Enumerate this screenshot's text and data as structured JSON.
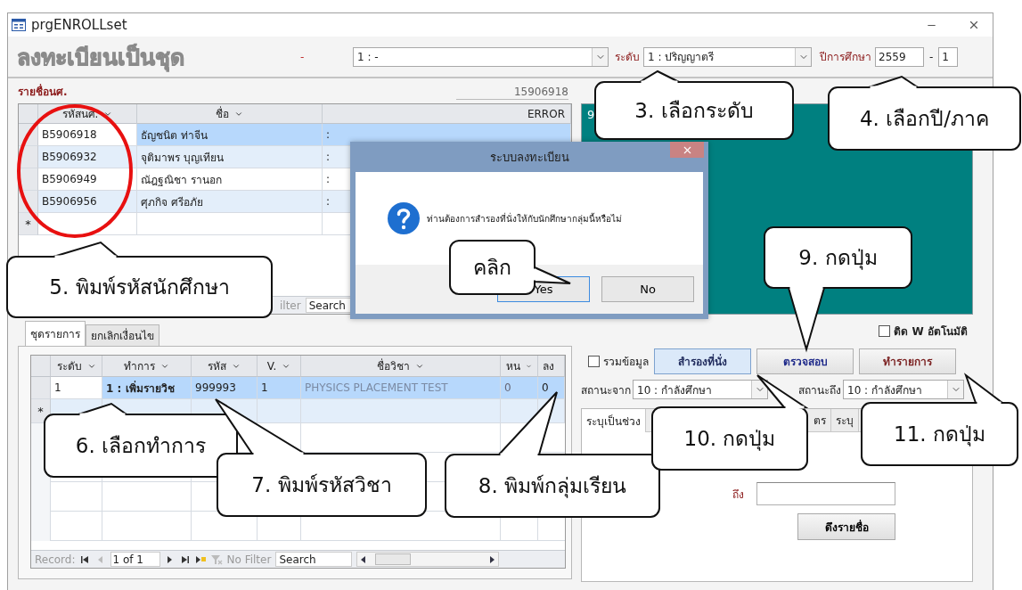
{
  "window": {
    "title": "prgENROLLset"
  },
  "header": {
    "title": "ลงทะเบียนเป็นชุด",
    "separator": "-",
    "program": "1 : -",
    "level_label": "ระดับ",
    "level": "1 : ปริญญาตรี",
    "year_label": "ปีการศึกษา",
    "year": "2559",
    "term_separator": "-",
    "term": "1"
  },
  "students": {
    "label": "รายชื่อนศ.",
    "current_id": "15906918",
    "columns": [
      "รหัสนศ.",
      "ชื่อ",
      "ERROR"
    ],
    "rows": [
      {
        "id": "B5906918",
        "name": "ธัญชนิต  ท่าจีน",
        "error": ":",
        "selected": true
      },
      {
        "id": "B5906932",
        "name": "จุติมาพร  บุญเทียน",
        "error": ":",
        "selected": false
      },
      {
        "id": "B5906949",
        "name": "ณัฎฐณิชา  รานอก",
        "error": ":",
        "selected": false
      },
      {
        "id": "B5906956",
        "name": "ศุภกิจ  ศรีอภัย",
        "error": ":",
        "selected": false
      }
    ],
    "new_row_marker": "*",
    "record_bar": {
      "filter": "ilter",
      "search": "Search"
    }
  },
  "result_panel": {
    "text": "9"
  },
  "auto_w": {
    "label": "ติด W อัตโนมัติ",
    "checked": false
  },
  "tabs": [
    {
      "label": "ชุดรายการ",
      "selected": true
    },
    {
      "label": "ยกเลิกเงื่อนไข",
      "selected": false
    }
  ],
  "courses": {
    "columns": [
      "ระดับ",
      "ทำการ",
      "รหัส",
      "V.",
      "ชื่อวิชา",
      "หน",
      "ลง"
    ],
    "rows": [
      {
        "cells": [
          "1",
          "1 : เพิ่มรายวิช",
          "999993",
          "1",
          "PHYSICS  PLACEMENT  TEST",
          "0",
          "0"
        ],
        "selected": true
      }
    ],
    "new_row_marker": "*",
    "record_bar": {
      "label": "Record:",
      "position": "1 of 1",
      "filter": "No Filter",
      "search": "Search"
    }
  },
  "actions": {
    "merge": {
      "label": "รวมข้อมูล",
      "checked": false
    },
    "buttons": [
      {
        "label": "สำรองที่นั่ง",
        "selected": true,
        "color": "#1f2a5c"
      },
      {
        "label": "ตรวจสอบ",
        "selected": false,
        "color": "#1f2a8a"
      },
      {
        "label": "ทำรายการ",
        "selected": false,
        "color": "#7a1f1f"
      }
    ]
  },
  "status": {
    "from_label": "สถานะจาก",
    "from": "10 : กำลังศึกษา",
    "to_label": "สถานะถึง",
    "to": "10 : กำลังศึกษา"
  },
  "range_tabs": [
    {
      "label": "ระบุเป็นช่วง",
      "selected": true
    },
    {
      "label": "ตร",
      "selected": false
    },
    {
      "label": "ระบุ",
      "selected": false
    }
  ],
  "range": {
    "to_label": "ถึง",
    "fetch_button": "ดึงรายชื่อ"
  },
  "dialog": {
    "title": "ระบบลงทะเบียน",
    "message": "ท่านต้องการสำรองที่นั่งให้กับนักศึกษากลุ่มนี้หรือไม่",
    "buttons": [
      {
        "label": "Yes",
        "selected": true
      },
      {
        "label": "No",
        "selected": false
      }
    ]
  },
  "annotations": [
    {
      "text": "3.  เลือกระดับ"
    },
    {
      "text": "4.  เลือกปี/ภาค"
    },
    {
      "text": "5.  พิมพ์รหัสนักศึกษา"
    },
    {
      "text": "คลิก"
    },
    {
      "text": "9.  กดปุ่ม"
    },
    {
      "text": "6.  เลือกทำการ"
    },
    {
      "text": "7.  พิมพ์รหัสวิชา"
    },
    {
      "text": "8.  พิมพ์กลุ่มเรียน"
    },
    {
      "text": "10.  กดปุ่ม"
    },
    {
      "text": "11.  กดปุ่ม"
    }
  ]
}
